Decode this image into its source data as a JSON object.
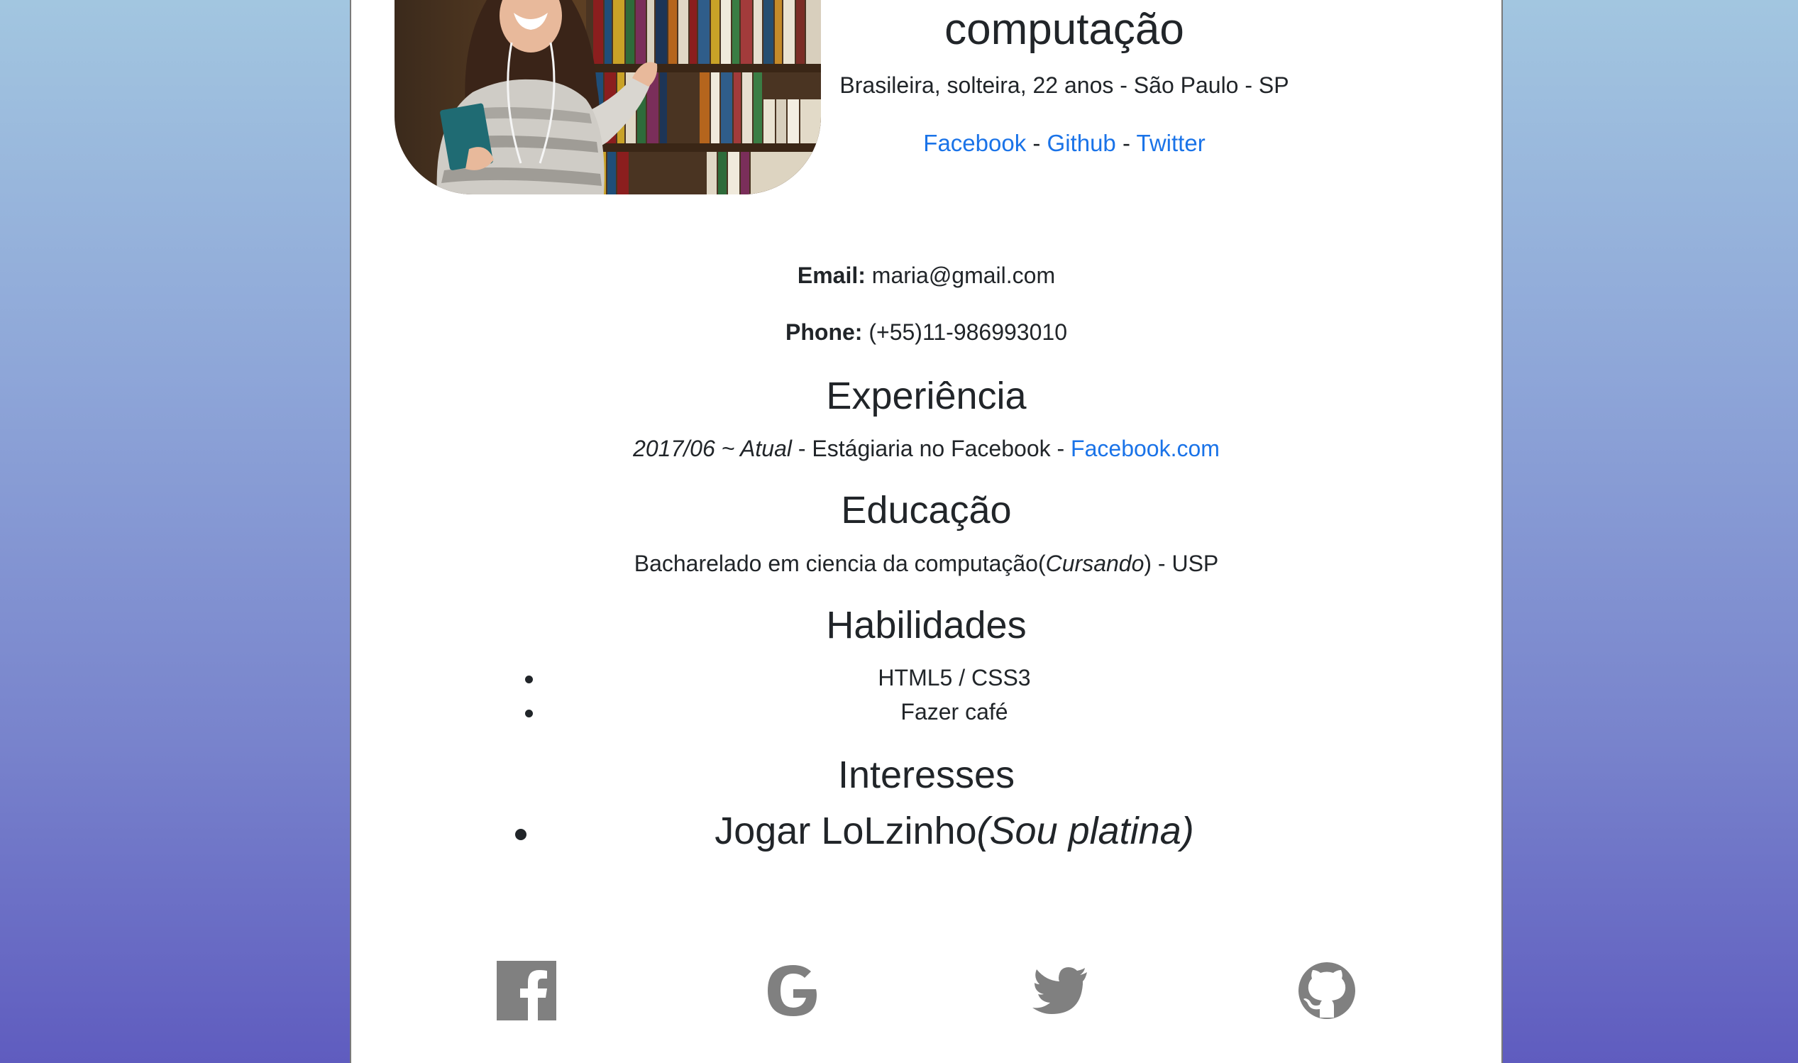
{
  "profile": {
    "title_text": "computação",
    "subtitle": "Brasileira, solteira, 22 anos - São Paulo - SP",
    "links": [
      {
        "label": "Facebook"
      },
      {
        "label": "Github"
      },
      {
        "label": "Twitter"
      }
    ],
    "separator": " - ",
    "photo_icon": "student-portrait-photo"
  },
  "contact": {
    "email_label": "Email:",
    "email_value": "maria@gmail.com",
    "phone_label": "Phone:",
    "phone_value": "(+55)11-986993010"
  },
  "experience": {
    "heading": "Experiência",
    "period": "2017/06 ~ Atual",
    "sep1": " - ",
    "role": "Estágiaria no Facebook",
    "sep2": " - ",
    "link_label": "Facebook.com"
  },
  "education": {
    "heading": "Educação",
    "course": "Bacharelado em ciencia da computação(",
    "status": "Cursando",
    "rest": ") - USP"
  },
  "skills": {
    "heading": "Habilidades",
    "items": [
      "HTML5 / CSS3",
      "Fazer café"
    ]
  },
  "interests": {
    "heading": "Interesses",
    "main": "Jogar LoLzinho",
    "note": "(Sou platina)"
  },
  "footer": {
    "icons": [
      "facebook-icon",
      "google-icon",
      "twitter-icon",
      "github-icon"
    ],
    "icon_color": "#808080"
  },
  "colors": {
    "link": "#1a73e8",
    "text": "#212529"
  }
}
